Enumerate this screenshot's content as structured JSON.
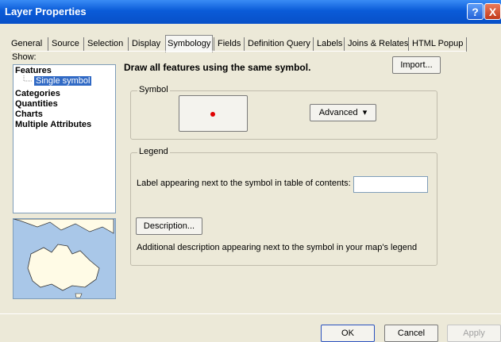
{
  "window": {
    "title": "Layer Properties",
    "help": "?",
    "close": "X"
  },
  "tabs": [
    "General",
    "Source",
    "Selection",
    "Display",
    "Symbology",
    "Fields",
    "Definition Query",
    "Labels",
    "Joins & Relates",
    "HTML Popup"
  ],
  "show": {
    "label": "Show:",
    "items": [
      "Features",
      "Single symbol",
      "Categories",
      "Quantities",
      "Charts",
      "Multiple Attributes"
    ]
  },
  "main": {
    "heading": "Draw all features using the same symbol.",
    "import_label": "Import...",
    "symbol_group": "Symbol",
    "advanced_label": "Advanced",
    "legend_group": "Legend",
    "label_prompt": "Label appearing next to the symbol in table of contents:",
    "label_value": "",
    "description_label": "Description...",
    "description_note": "Additional description appearing next to the symbol in your map's legend"
  },
  "buttons": {
    "ok": "OK",
    "cancel": "Cancel",
    "apply": "Apply"
  },
  "colors": {
    "symbol": "#e00000",
    "title_bar": "#0a5bd8"
  }
}
